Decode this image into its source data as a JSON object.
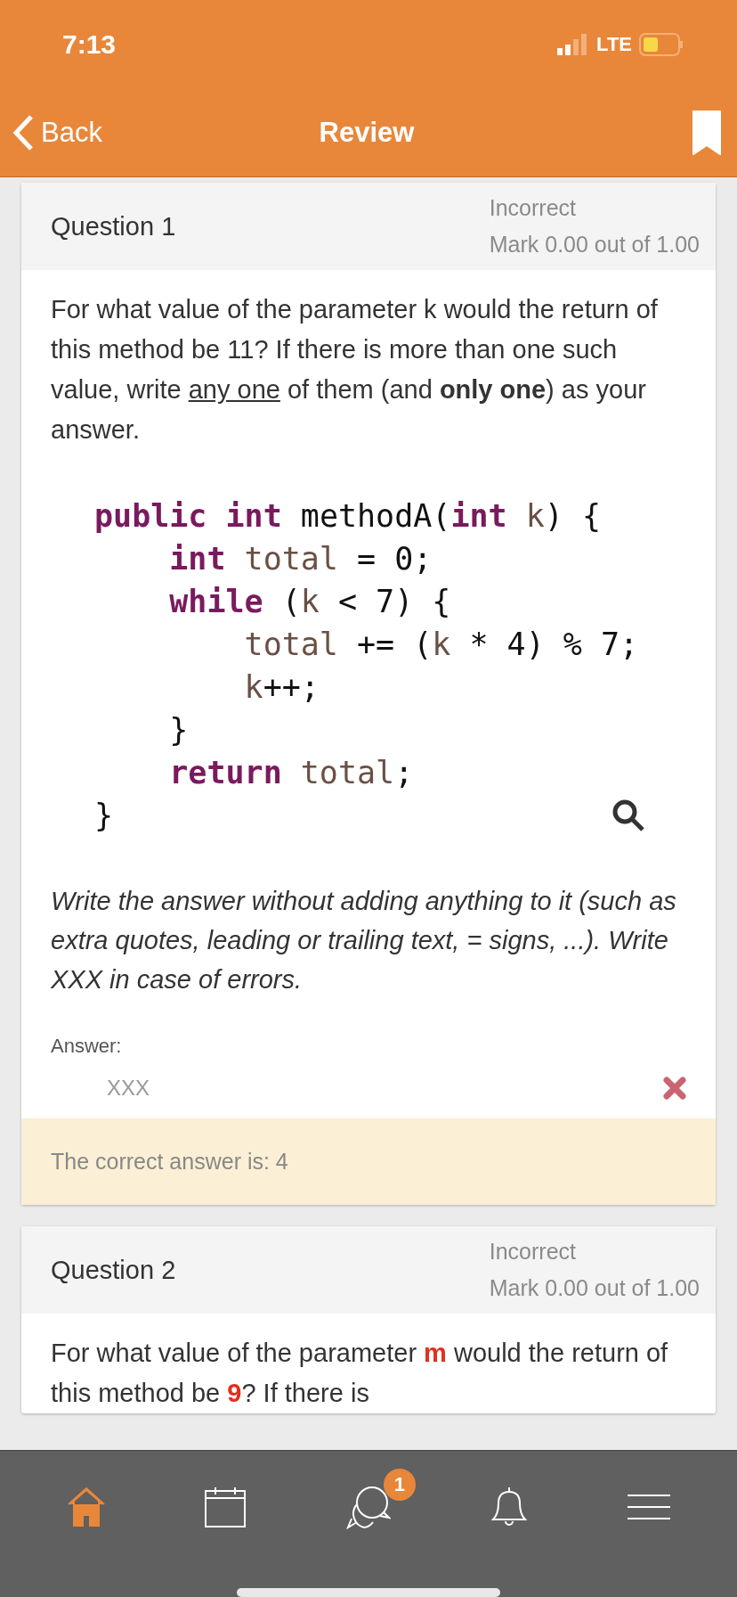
{
  "status_bar": {
    "time": "7:13",
    "network": "LTE"
  },
  "nav_bar": {
    "back": "Back",
    "title": "Review",
    "bookmarked": true
  },
  "questions": [
    {
      "title": "Question 1",
      "state": "Incorrect",
      "mark": "Mark 0.00 out of 1.00",
      "text": [
        {
          "kind": "plain",
          "text": "For what value of the parameter k would the return of this method be 11? If there is more than one such value, write "
        },
        {
          "kind": "underline",
          "text": "any one"
        },
        {
          "kind": "plain",
          "text": " of them (and "
        },
        {
          "kind": "bold",
          "text": "only one"
        },
        {
          "kind": "plain",
          "text": ") as your answer."
        }
      ],
      "code": [
        [
          {
            "kind": "keyword",
            "text": "public"
          },
          {
            "kind": "keyword",
            "text": " int"
          },
          {
            "kind": "plain",
            "text": " methodA("
          },
          {
            "kind": "keyword",
            "text": "int"
          },
          {
            "kind": "ident",
            "text": " k"
          },
          {
            "kind": "plain",
            "text": ") {"
          }
        ],
        [
          {
            "kind": "keyword",
            "text": "    int"
          },
          {
            "kind": "ident",
            "text": " total"
          },
          {
            "kind": "plain",
            "text": " = 0;"
          }
        ],
        [
          {
            "kind": "keyword",
            "text": "    while"
          },
          {
            "kind": "plain",
            "text": " ("
          },
          {
            "kind": "ident",
            "text": "k"
          },
          {
            "kind": "plain",
            "text": " < 7) {"
          }
        ],
        [
          {
            "kind": "ident",
            "text": "        total"
          },
          {
            "kind": "plain",
            "text": " += ("
          },
          {
            "kind": "ident",
            "text": "k"
          },
          {
            "kind": "plain",
            "text": " * 4) % 7;"
          }
        ],
        [
          {
            "kind": "ident",
            "text": "        k"
          },
          {
            "kind": "plain",
            "text": "++;"
          }
        ],
        [
          {
            "kind": "plain",
            "text": "    }"
          }
        ],
        [
          {
            "kind": "keyword",
            "text": "    return"
          },
          {
            "kind": "ident",
            "text": " total"
          },
          {
            "kind": "plain",
            "text": ";"
          }
        ],
        [
          {
            "kind": "plain",
            "text": "}"
          }
        ]
      ],
      "instruction": "Write the answer without adding anything to it (such as extra quotes, leading or trailing text, = signs, ...). Write XXX in case of errors.",
      "answer_label": "Answer:",
      "answer": "XXX",
      "correct": false,
      "feedback": "The correct answer is: 4"
    },
    {
      "title": "Question 2",
      "state": "Incorrect",
      "mark": "Mark 0.00 out of 1.00",
      "text": [
        {
          "kind": "plain",
          "text": "For what value of the parameter "
        },
        {
          "kind": "alert",
          "text": "m"
        },
        {
          "kind": "plain",
          "text": " would the return of this method be "
        },
        {
          "kind": "alert",
          "text": "9"
        },
        {
          "kind": "plain",
          "text": "? If there is"
        }
      ]
    }
  ],
  "tab_bar": [
    {
      "kind": "home",
      "selected": true
    },
    {
      "kind": "calendar",
      "selected": false
    },
    {
      "kind": "chat",
      "selected": false,
      "badge": "1"
    },
    {
      "kind": "bell",
      "selected": false
    },
    {
      "kind": "menu",
      "selected": false
    }
  ]
}
